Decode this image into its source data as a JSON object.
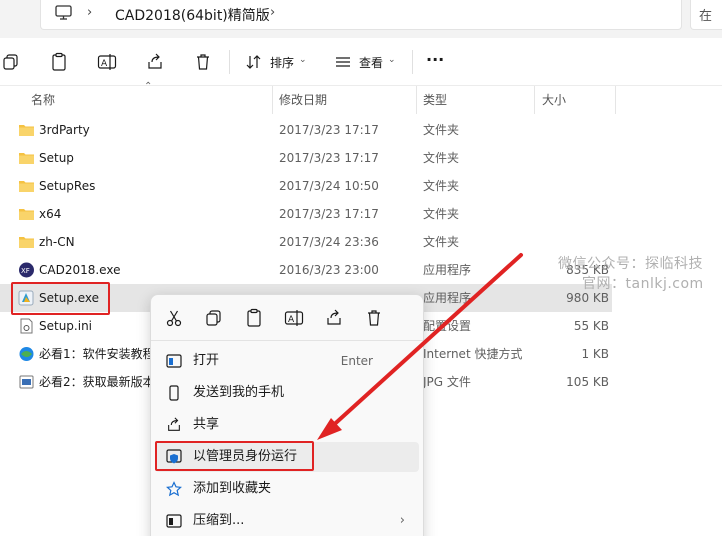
{
  "address_bar": {
    "path_label": "CAD2018(64bit)精简版",
    "right_partial": "在"
  },
  "toolbar": {
    "sort_label": "排序",
    "view_label": "查看",
    "more_label": "···"
  },
  "columns": {
    "name": "名称",
    "modified": "修改日期",
    "type": "类型",
    "size": "大小"
  },
  "files": [
    {
      "name": "3rdParty",
      "modified": "2017/3/23 17:17",
      "type": "文件夹",
      "size": "",
      "icon": "folder-icon"
    },
    {
      "name": "Setup",
      "modified": "2017/3/23 17:17",
      "type": "文件夹",
      "size": "",
      "icon": "folder-icon"
    },
    {
      "name": "SetupRes",
      "modified": "2017/3/24 10:50",
      "type": "文件夹",
      "size": "",
      "icon": "folder-icon"
    },
    {
      "name": "x64",
      "modified": "2017/3/23 17:17",
      "type": "文件夹",
      "size": "",
      "icon": "folder-icon"
    },
    {
      "name": "zh-CN",
      "modified": "2017/3/24 23:36",
      "type": "文件夹",
      "size": "",
      "icon": "folder-icon"
    },
    {
      "name": "CAD2018.exe",
      "modified": "2016/3/23 23:00",
      "type": "应用程序",
      "size": "835 KB",
      "icon": "cad-app-icon"
    },
    {
      "name": "Setup.exe",
      "modified": "",
      "type": "应用程序",
      "size": "980 KB",
      "icon": "setup-exe-icon",
      "selected": true
    },
    {
      "name": "Setup.ini",
      "modified": "",
      "type": "配置设置",
      "size": "55 KB",
      "icon": "ini-file-icon"
    },
    {
      "name": "必看1：软件安装教程",
      "modified": "",
      "type": "Internet 快捷方式",
      "size": "1 KB",
      "icon": "internet-shortcut-icon"
    },
    {
      "name": "必看2：获取最新版本",
      "modified": "",
      "type": "JPG 文件",
      "size": "105 KB",
      "icon": "jpg-file-icon"
    }
  ],
  "context_menu": {
    "top_icons": [
      "cut-icon",
      "copy-icon",
      "paste-icon",
      "rename-icon",
      "share-icon",
      "delete-icon"
    ],
    "items": [
      {
        "label": "打开",
        "hint": "Enter",
        "icon": "open-icon"
      },
      {
        "label": "发送到我的手机",
        "hint": "",
        "icon": "phone-icon"
      },
      {
        "label": "共享",
        "hint": "",
        "icon": "share-icon"
      },
      {
        "label": "以管理员身份运行",
        "hint": "",
        "icon": "admin-shield-icon",
        "highlighted": true
      },
      {
        "label": "添加到收藏夹",
        "hint": "",
        "icon": "star-icon"
      },
      {
        "label": "压缩到...",
        "hint": "",
        "icon": "zip-icon",
        "submenu": true
      }
    ]
  },
  "watermark": {
    "line1": "微信公众号：探临科技",
    "line2": "官网：tanlkj.com"
  },
  "colors": {
    "annotation_red": "#e02323",
    "folder_yellow": "#f5c242",
    "selection_gray": "#e5e5e5",
    "accent_blue": "#1a6fd1"
  }
}
